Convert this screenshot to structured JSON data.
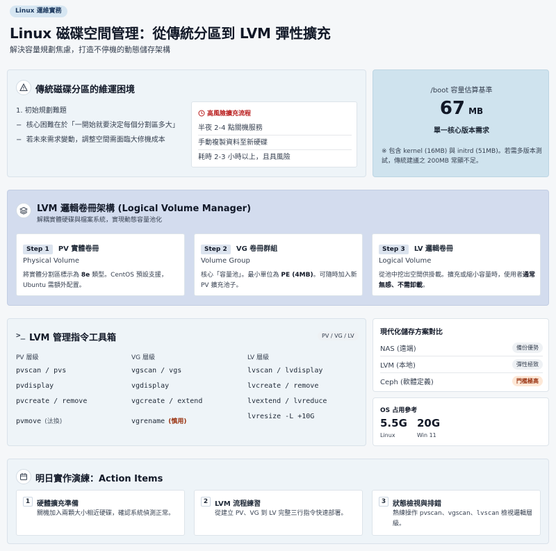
{
  "header": {
    "tag": "Linux 運維實務",
    "title": "Linux 磁碟空間管理：從傳統分區到 LVM 彈性擴充",
    "subtitle": "解決容量規劃焦慮，打造不停機的動態儲存架構"
  },
  "traditional": {
    "title": "傳統磁碟分區的維運困境",
    "section_label": "1. 初始規劃難題",
    "bullets": [
      "核心困難在於「一開始就要決定每個分割區多大」",
      "若未來需求變動，調整空間需面臨大修機成本"
    ],
    "risk_title": "高風險擴充流程",
    "risk_items": [
      "半夜 2-4 點關機服務",
      "手動複製資料至新硬碟",
      "耗時 2-3 小時以上，且具風險"
    ]
  },
  "boot": {
    "label": "/boot 容量估算基準",
    "value": "67",
    "unit": "MB",
    "desc": "單一核心版本需求",
    "note": "※ 包含 kernel (16MB) 與 initrd (51MB)。若需多版本測試，傳統建議之 200MB 常顯不足。"
  },
  "lvm": {
    "title": "LVM 邏輯卷冊架構 (Logical Volume Manager)",
    "subtitle": "解耦實體硬碟與檔案系統，實現動態容量池化",
    "steps": [
      {
        "badge": "Step 1",
        "title": "PV 實體卷冊",
        "en": "Physical Volume",
        "desc_a": "將實體分割區標示為 ",
        "desc_b": "8e",
        "desc_c": " 類型。CentOS 預設支援，Ubuntu 需額外配置。"
      },
      {
        "badge": "Step 2",
        "title": "VG 卷冊群組",
        "en": "Volume Group",
        "desc_a": "核心「容量池」。最小單位為 ",
        "desc_b": "PE (4MB)",
        "desc_c": "。可隨時加入新 PV 擴充池子。"
      },
      {
        "badge": "Step 3",
        "title": "LV 邏輯卷冊",
        "en": "Logical Volume",
        "desc_a": "從池中挖出空間供掛載。擴充或縮小容量時，使用者",
        "desc_b": "通常無感、不需卸載",
        "desc_c": "。"
      }
    ]
  },
  "toolbox": {
    "title": "LVM 管理指令工具箱",
    "badge": "PV / VG / LV",
    "columns": [
      {
        "header": "PV 層級",
        "items": [
          "pvscan / pvs",
          "pvdisplay",
          "pvcreate / remove",
          "pvmove"
        ],
        "note": "(汰換)"
      },
      {
        "header": "VG 層級",
        "items": [
          "vgscan / vgs",
          "vgdisplay",
          "vgcreate / extend",
          "vgrename"
        ],
        "note": "(慎用)"
      },
      {
        "header": "LV 層級",
        "items": [
          "lvscan / lvdisplay",
          "lvcreate / remove",
          "lvextend / lvreduce",
          "lvresize -L +10G"
        ],
        "note": ""
      }
    ]
  },
  "compare": {
    "title": "現代化儲存方案對比",
    "rows": [
      {
        "name": "NAS (遠端)",
        "tag": "備份優勢",
        "accent": "#374151",
        "bg": "#eef1f4"
      },
      {
        "name": "LVM (本地)",
        "tag": "彈性極致",
        "accent": "#374151",
        "bg": "#eef1f4"
      },
      {
        "name": "Ceph (軟體定義)",
        "tag": "門檻極高",
        "accent": "#9a3412",
        "bg": "#fde8d7"
      }
    ]
  },
  "os": {
    "title": "OS 占用參考",
    "items": [
      {
        "value": "5.5G",
        "label": "Linux"
      },
      {
        "value": "20G",
        "label": "Win 11"
      }
    ]
  },
  "actions": {
    "title": "明日實作演練：Action Items",
    "items": [
      {
        "num": "1",
        "title": "硬體擴充準備",
        "desc": "關機加入兩顆大小相近硬碟，確認系統偵測正常。"
      },
      {
        "num": "2",
        "title": "LVM 流程練習",
        "desc": "從建立 PV、VG 到 LV 完整三行指令快速部署。"
      },
      {
        "num": "3",
        "title": "狀態檢視與排錯",
        "desc_a": "熟練操作 pvscan、vgscan、",
        "desc_mono": "lvscan",
        "desc_b": " 檢視邏輯層級。"
      }
    ]
  },
  "colors": {
    "accent_red": "#b91c1c",
    "brand_blue": "#1e3a5f"
  }
}
